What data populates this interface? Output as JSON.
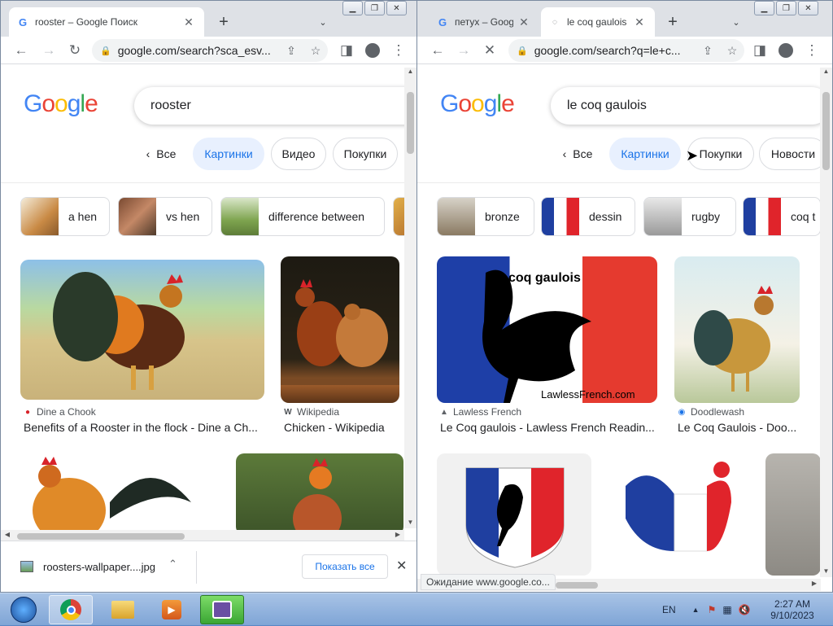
{
  "left": {
    "tabs": [
      {
        "title": "rooster – Google Поиск"
      }
    ],
    "url": "google.com/search?sca_esv...",
    "logo": [
      "G",
      "o",
      "o",
      "g",
      "l",
      "e"
    ],
    "query": "rooster",
    "filters": {
      "all": "Все",
      "images": "Картинки",
      "video": "Видео",
      "shopping": "Покупки"
    },
    "related": [
      {
        "label": "a hen"
      },
      {
        "label": "vs hen"
      },
      {
        "label": "difference between"
      }
    ],
    "results": [
      {
        "source": "Dine a Chook",
        "title": "Benefits of a Rooster in the flock - Dine a Ch..."
      },
      {
        "source": "Wikipedia",
        "source_icon": "W",
        "title": "Chicken - Wikipedia"
      }
    ],
    "download": {
      "filename": "roosters-wallpaper....jpg",
      "show_all": "Показать все"
    }
  },
  "right": {
    "tabs": [
      {
        "title": "петух – Goog"
      },
      {
        "title": "le coq gaulois"
      }
    ],
    "url": "google.com/search?q=le+c...",
    "query": "le coq gaulois",
    "filters": {
      "all": "Все",
      "images": "Картинки",
      "shopping": "Покупки",
      "news": "Новости"
    },
    "related": [
      {
        "label": "bronze"
      },
      {
        "label": "dessin"
      },
      {
        "label": "rugby"
      },
      {
        "label": "coq t"
      }
    ],
    "results": [
      {
        "source": "Lawless French",
        "title": "Le Coq gaulois - Lawless French Readin...",
        "overlay_top": "coq gaulois",
        "overlay_bottom": "LawlessFrench.com"
      },
      {
        "source": "Doodlewash",
        "title": "Le Coq Gaulois - Doo..."
      }
    ],
    "status": "Ожидание www.google.co..."
  },
  "taskbar": {
    "lang": "EN",
    "time": "2:27 AM",
    "date": "9/10/2023"
  }
}
